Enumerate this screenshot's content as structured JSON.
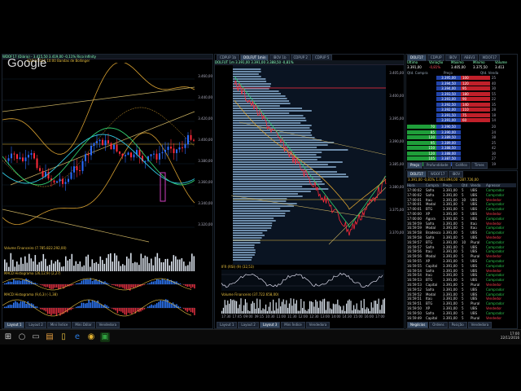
{
  "watermark": {
    "text": "Google"
  },
  "left_chart": {
    "title": "WDOF17 (Diário) - 3.415,50  3.419,00 -0,11%  Rico Infinity",
    "date": "22/11/2016 10:00",
    "bollinger_label": "Bandas de Bollinger",
    "price_labels": [
      "3.460,00",
      "3.440,00",
      "3.420,00",
      "3.400,00",
      "3.380,00",
      "3.360,00",
      "3.340,00",
      "3.320,00"
    ],
    "volume_title": "Volume Financeiro (7.785.822.292,00)",
    "macd1_title": "MACD Histograma (26,12,9) (2,27)",
    "macd2_title": "MACD Histograma (9,6,3) (-1,38)",
    "tabs": [
      "Layout 1",
      "Layout 2",
      "Mini Índice",
      "Mini Dólar",
      "Vendedora"
    ],
    "active_tab": 0
  },
  "mid_chart": {
    "top_tabs": [
      "CDPUP 1b",
      "DOLFUT 1min",
      "IBOV 1b",
      "CDPUP 2",
      "CDPUP 5"
    ],
    "title": "DOLFUT 1m  3.391,00  3.391,00  3.388,50  -0,81%",
    "right_prices": [
      "3.405,00",
      "3.400,00",
      "3.395,00",
      "3.390,00",
      "3.385,00",
      "3.380,00",
      "3.375,00",
      "3.370,00"
    ],
    "ifr_title": "IFR (RSI) (9) (32,53)",
    "volume_title": "Volume Financeiro (37.722.658,00)",
    "time_labels": [
      "17:30",
      "17:45",
      "09:00",
      "09:15",
      "10:30",
      "11:00",
      "11:30",
      "12:00",
      "12:30",
      "13:00",
      "14:00",
      "14:30",
      "15:00",
      "16:00",
      "17:00"
    ],
    "tabs": [
      "Layout 1",
      "Layout 2",
      "Layout 3",
      "Mini Índice",
      "Vendedora"
    ],
    "active_tab": 2
  },
  "book": {
    "tabs": [
      "DOLF17",
      "CDPUP",
      "IBOV",
      "ABEV3",
      "WDOF17"
    ],
    "header": [
      "Último",
      "Variação",
      "Máximo",
      "Mínimo",
      "Volume"
    ],
    "quote": {
      "last": "3.391,00",
      "var": "-0,81%",
      "max": "3.405,00",
      "min": "3.375,50",
      "vol": "3.413"
    },
    "col_labels": [
      "Qtd. Compra",
      "Preço",
      "Qtd. Venda"
    ],
    "asks": [
      {
        "qty": "100",
        "price": "3.395,00",
        "vol": "25"
      },
      {
        "qty": "120",
        "price": "3.394,50",
        "vol": "40"
      },
      {
        "qty": "95",
        "price": "3.394,00",
        "vol": "30"
      },
      {
        "qty": "180",
        "price": "3.393,50",
        "vol": "55"
      },
      {
        "qty": "90",
        "price": "3.393,00",
        "vol": "22"
      },
      {
        "qty": "140",
        "price": "3.392,50",
        "vol": "35"
      },
      {
        "qty": "110",
        "price": "3.392,00",
        "vol": "28"
      },
      {
        "qty": "75",
        "price": "3.391,50",
        "vol": "18"
      },
      {
        "qty": "60",
        "price": "3.391,00",
        "vol": "14"
      }
    ],
    "bids": [
      {
        "qty": "70",
        "price": "3.390,50",
        "vol": "20"
      },
      {
        "qty": "85",
        "price": "3.390,00",
        "vol": "24"
      },
      {
        "qty": "130",
        "price": "3.389,50",
        "vol": "38"
      },
      {
        "qty": "95",
        "price": "3.389,00",
        "vol": "25"
      },
      {
        "qty": "150",
        "price": "3.388,50",
        "vol": "42"
      },
      {
        "qty": "120",
        "price": "3.388,00",
        "vol": "30"
      },
      {
        "qty": "105",
        "price": "3.387,50",
        "vol": "27"
      },
      {
        "qty": "80",
        "price": "3.387,00",
        "vol": "19"
      }
    ],
    "bottom_tabs": [
      "Preço",
      "Profundidade",
      "Gráfico",
      "Times"
    ],
    "colors": {
      "ask": "#c0202a",
      "bid": "#1f9e3a",
      "mid": "#2244aa"
    }
  },
  "trades": {
    "tabs": [
      "DOLF17",
      "WDOF17",
      "IBOV"
    ],
    "header": [
      "Data",
      "Hora",
      "Compra",
      "Preço",
      "Qtd",
      "Venda",
      "Agressor"
    ],
    "summary": "3.391,00   -0,81%   1.003.894,00   -287.726,00",
    "rows": [
      [
        "17:00:02",
        "Safra",
        "3.391,00",
        "5",
        "UBS",
        "Comprador"
      ],
      [
        "17:00:02",
        "Safra",
        "3.391,00",
        "5",
        "UBS",
        "Comprador"
      ],
      [
        "17:00:01",
        "Itaú",
        "3.391,00",
        "10",
        "UBS",
        "Vendedor"
      ],
      [
        "17:00:01",
        "Modal",
        "3.391,00",
        "5",
        "UBS",
        "Comprador"
      ],
      [
        "17:00:01",
        "BTG",
        "3.391,00",
        "5",
        "UBS",
        "Comprador"
      ],
      [
        "17:00:00",
        "XP",
        "3.391,00",
        "5",
        "UBS",
        "Vendedor"
      ],
      [
        "17:00:00",
        "Ágora",
        "3.391,00",
        "5",
        "UBS",
        "Comprador"
      ],
      [
        "16:59:59",
        "Safra",
        "3.391,00",
        "5",
        "Itaú",
        "Vendedor"
      ],
      [
        "16:59:59",
        "Modal",
        "3.391,00",
        "5",
        "Itaú",
        "Comprador"
      ],
      [
        "16:59:58",
        "Bradesco",
        "3.391,00",
        "5",
        "UBS",
        "Comprador"
      ],
      [
        "16:59:58",
        "Safra",
        "3.391,00",
        "5",
        "UBS",
        "Vendedor"
      ],
      [
        "16:59:57",
        "BTG",
        "3.391,00",
        "10",
        "Plural",
        "Comprador"
      ],
      [
        "16:59:57",
        "Safra",
        "3.391,00",
        "5",
        "UBS",
        "Comprador"
      ],
      [
        "16:59:56",
        "Itaú",
        "3.391,00",
        "5",
        "UBS",
        "Comprador"
      ],
      [
        "16:59:56",
        "Modal",
        "3.391,00",
        "5",
        "Plural",
        "Vendedor"
      ],
      [
        "16:59:55",
        "XP",
        "3.391,00",
        "5",
        "UBS",
        "Comprador"
      ],
      [
        "16:59:55",
        "Capital",
        "3.391,00",
        "5",
        "UBS",
        "Comprador"
      ],
      [
        "16:59:54",
        "Safra",
        "3.391,00",
        "5",
        "UBS",
        "Vendedor"
      ],
      [
        "16:59:54",
        "Itaú",
        "3.391,00",
        "5",
        "UBS",
        "Comprador"
      ],
      [
        "16:59:53",
        "BTG",
        "3.391,00",
        "5",
        "UBS",
        "Comprador"
      ],
      [
        "16:59:53",
        "Capital",
        "3.391,00",
        "5",
        "Plural",
        "Vendedor"
      ],
      [
        "16:59:52",
        "Safra",
        "3.391,00",
        "5",
        "UBS",
        "Comprador"
      ],
      [
        "16:59:52",
        "Modal",
        "3.391,00",
        "5",
        "UBS",
        "Comprador"
      ],
      [
        "16:59:51",
        "Itaú",
        "3.391,00",
        "5",
        "UBS",
        "Vendedor"
      ],
      [
        "16:59:51",
        "BTG",
        "3.391,00",
        "5",
        "Plural",
        "Comprador"
      ],
      [
        "16:59:50",
        "XP",
        "3.391,00",
        "5",
        "UBS",
        "Vendedor"
      ],
      [
        "16:59:50",
        "Safra",
        "3.391,00",
        "5",
        "UBS",
        "Comprador"
      ],
      [
        "16:59:49",
        "Capital",
        "3.391,00",
        "5",
        "Plural",
        "Vendedor"
      ]
    ],
    "bottom_tabs": [
      "Negócios",
      "Ordens",
      "Posição",
      "Vendedora"
    ]
  },
  "taskbar": {
    "icons": [
      "start-windows",
      "search",
      "task-view",
      "store",
      "explorer",
      "edge",
      "chrome",
      "profit-app"
    ],
    "clock_time": "17:00",
    "clock_date": "22/11/2016"
  }
}
